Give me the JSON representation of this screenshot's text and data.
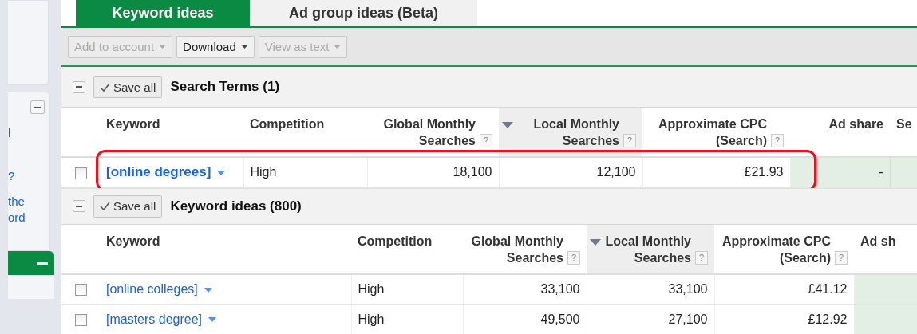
{
  "sidebar": {
    "fragments": [
      "l",
      "?",
      "the",
      "ord"
    ],
    "panel_expanded": true
  },
  "tabs": [
    {
      "label": "Keyword ideas",
      "selected": true
    },
    {
      "label": "Ad group ideas (Beta)",
      "selected": false
    }
  ],
  "toolbar": [
    {
      "label": "Add to account",
      "disabled": true
    },
    {
      "label": "Download",
      "disabled": false
    },
    {
      "label": "View as text",
      "disabled": true
    }
  ],
  "sections": [
    {
      "title": "Search Terms (1)",
      "save_label": "Save all",
      "expanded": true,
      "columns": [
        {
          "label": "Keyword",
          "kind": "keyword",
          "sorted": false
        },
        {
          "label": "Competition",
          "kind": "text",
          "sorted": false
        },
        {
          "label": "Global Monthly Searches",
          "kind": "number",
          "help": "?",
          "sorted": false
        },
        {
          "label": "Local Monthly Searches",
          "kind": "number",
          "help": "?",
          "sorted": true
        },
        {
          "label": "Approximate CPC (Search)",
          "kind": "number",
          "help": "?",
          "sorted": false
        },
        {
          "label": "Ad share",
          "kind": "share",
          "sorted": false
        },
        {
          "label": "Se",
          "kind": "cut",
          "sorted": false
        }
      ],
      "rows": [
        {
          "checked": false,
          "highlighted": true,
          "cells": [
            "[online degrees]",
            "High",
            "18,100",
            "12,100",
            "£21.93",
            "-",
            ""
          ]
        }
      ]
    },
    {
      "title": "Keyword ideas (800)",
      "save_label": "Save all",
      "expanded": true,
      "columns": [
        {
          "label": "Keyword",
          "kind": "keyword",
          "sorted": false
        },
        {
          "label": "Competition",
          "kind": "text",
          "sorted": false
        },
        {
          "label": "Global Monthly Searches",
          "kind": "number",
          "help": "?",
          "sorted": false
        },
        {
          "label": "Local Monthly Searches",
          "kind": "number",
          "help": "?",
          "sorted": true
        },
        {
          "label": "Approximate CPC (Search)",
          "kind": "number",
          "help": "?",
          "sorted": false
        },
        {
          "label": "Ad sh",
          "kind": "cut",
          "sorted": false
        }
      ],
      "rows": [
        {
          "checked": false,
          "highlighted": false,
          "cells": [
            "[online colleges]",
            "High",
            "33,100",
            "33,100",
            "£41.12",
            ""
          ]
        },
        {
          "checked": false,
          "highlighted": false,
          "cells": [
            "[masters degree]",
            "High",
            "49,500",
            "27,100",
            "£12.92",
            ""
          ]
        }
      ]
    }
  ]
}
